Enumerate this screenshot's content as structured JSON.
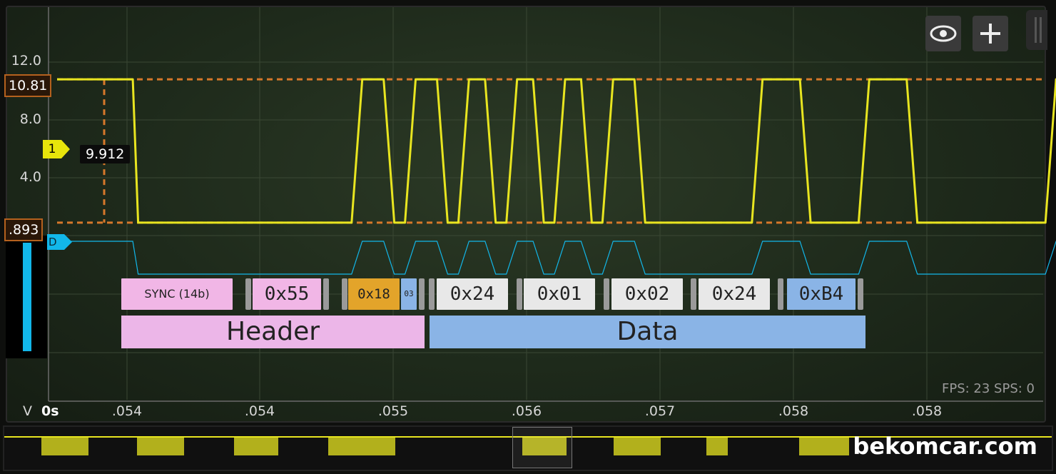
{
  "axis": {
    "unit_label": "V",
    "origin_label": "0s",
    "y_ticks": [
      "12.0",
      "8.0",
      "4.0"
    ],
    "x_ticks": [
      ".054",
      ".054",
      ".055",
      ".056",
      ".057",
      ".058",
      ".058"
    ]
  },
  "markers": {
    "upper": "10.81",
    "lower": ".893",
    "channel_1": "1",
    "channel_d": "D",
    "readout": "9.912"
  },
  "toolbar": {
    "eye_icon": "eye-icon",
    "add_icon": "plus-icon"
  },
  "decode": {
    "bytes": [
      {
        "label": "SYNC (14b)",
        "color": "#f1b6e6"
      },
      {
        "label": "0x55",
        "color": "#f1b6e6"
      },
      {
        "label": "0x18",
        "color": "#e3a42a"
      },
      {
        "label": "03",
        "color": "#8ab4e6"
      },
      {
        "label": "0x24",
        "color": "#e8e8e8"
      },
      {
        "label": "0x01",
        "color": "#e8e8e8"
      },
      {
        "label": "0x02",
        "color": "#e8e8e8"
      },
      {
        "label": "0x24",
        "color": "#e8e8e8"
      },
      {
        "label": "0xB4",
        "color": "#8ab4e6"
      }
    ],
    "groups": [
      {
        "label": "Header",
        "color": "#ecb6e8"
      },
      {
        "label": "Data",
        "color": "#8ab4e6"
      }
    ]
  },
  "status": {
    "fps": "FPS: 23  SPS: 0"
  },
  "watermark": "bekomcar.com",
  "colors": {
    "signal": "#e8e520",
    "digital": "#12b7ea",
    "cursor": "#d7782a"
  },
  "chart_data": {
    "type": "line",
    "title": "",
    "xlabel": "",
    "ylabel": "V",
    "ylim": [
      0,
      13
    ],
    "series": [
      {
        "values_note": "",
        "edges": [
          [
            0.0,
            10.81
          ],
          [
            0.0539,
            10.81
          ],
          [
            0.05392,
            0.893
          ],
          [
            0.05472,
            0.893
          ],
          [
            0.05476,
            10.81
          ],
          [
            0.05484,
            10.81
          ],
          [
            0.05488,
            0.893
          ],
          [
            0.05492,
            0.893
          ],
          [
            0.05496,
            10.81
          ],
          [
            0.05504,
            10.81
          ],
          [
            0.05508,
            0.893
          ],
          [
            0.05512,
            0.893
          ],
          [
            0.05516,
            10.81
          ],
          [
            0.05522,
            10.81
          ],
          [
            0.05526,
            0.893
          ],
          [
            0.0553,
            0.893
          ],
          [
            0.05534,
            10.81
          ],
          [
            0.0554,
            10.81
          ],
          [
            0.05544,
            0.893
          ],
          [
            0.05548,
            0.893
          ],
          [
            0.05552,
            10.81
          ],
          [
            0.05558,
            10.81
          ],
          [
            0.05562,
            0.893
          ],
          [
            0.05566,
            0.893
          ],
          [
            0.0557,
            10.81
          ],
          [
            0.05578,
            10.81
          ],
          [
            0.05582,
            0.893
          ],
          [
            0.05622,
            0.893
          ],
          [
            0.05626,
            10.81
          ],
          [
            0.0564,
            10.81
          ],
          [
            0.05644,
            0.893
          ],
          [
            0.05662,
            0.893
          ],
          [
            0.05666,
            10.81
          ],
          [
            0.0568,
            10.81
          ],
          [
            0.05684,
            0.893
          ],
          [
            0.05732,
            0.893
          ],
          [
            0.05736,
            10.81
          ],
          [
            0.05742,
            10.81
          ],
          [
            0.05746,
            0.893
          ],
          [
            0.05756,
            0.893
          ],
          [
            0.0576,
            10.81
          ],
          [
            0.05766,
            10.81
          ],
          [
            0.0577,
            0.893
          ],
          [
            0.0588,
            0.893
          ],
          [
            0.05884,
            10.81
          ],
          [
            0.0595,
            10.81
          ]
        ]
      }
    ]
  }
}
